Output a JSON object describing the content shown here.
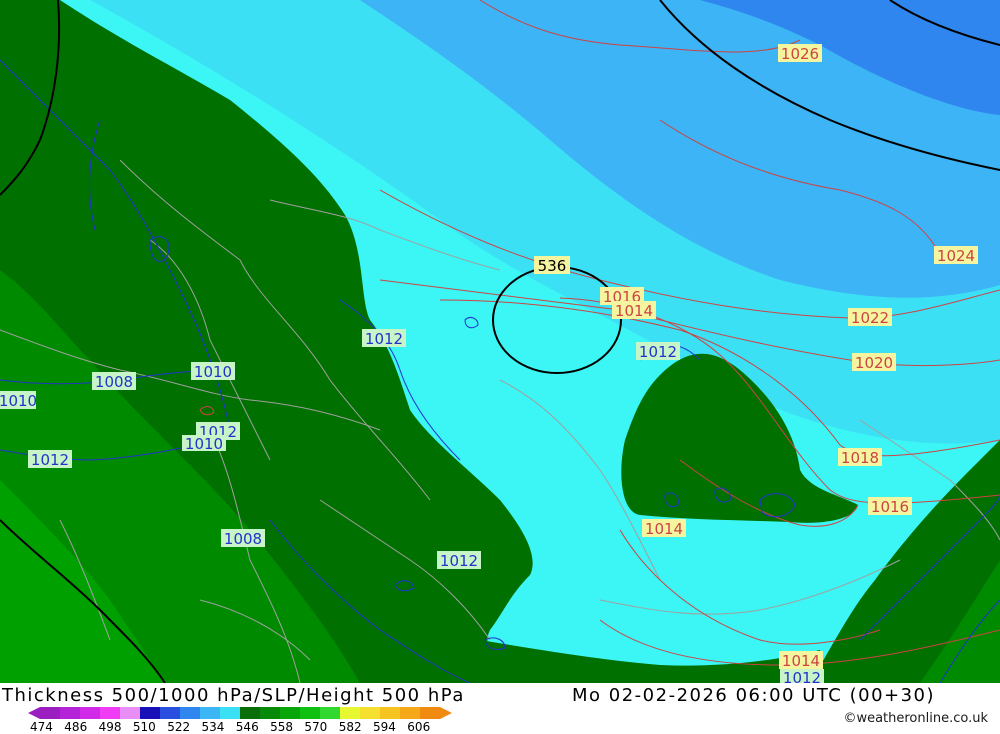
{
  "footer": {
    "title": "Thickness 500/1000 hPa/SLP/Height 500 hPa",
    "valid_time": "Mo 02-02-2026 06:00 UTC (00+30)",
    "credit": "©weatheronline.co.uk"
  },
  "legend": {
    "ticks": [
      "474",
      "486",
      "498",
      "510",
      "522",
      "534",
      "546",
      "558",
      "570",
      "582",
      "594",
      "606"
    ],
    "colors": [
      "#9b1fc0",
      "#b423d8",
      "#d02ae8",
      "#f03cf5",
      "#e88ef5",
      "#1a10b8",
      "#2a4fe0",
      "#2f86ee",
      "#3cb6f5",
      "#3ce0f5",
      "#0a6e0a",
      "#078a07",
      "#08a608",
      "#10c010",
      "#30d830",
      "#e8f830",
      "#f5e030",
      "#f5c420",
      "#f5a818",
      "#f08a10"
    ]
  },
  "map": {
    "colors": {
      "dark_green": "#007000",
      "mid_green": "#008a00",
      "green": "#00a000",
      "cyan": "#3cf5f5",
      "light_cyan": "#3ce0f5",
      "sky_blue": "#3cb4f5",
      "blue": "#2f86ee",
      "isobar_red": "#cc4444",
      "isobar_blue": "#2233cc",
      "coast_gray": "#a0a0a0",
      "label_bg_yellow": "#f5f5a0",
      "label_bg_green": "#c8f5c8"
    },
    "height_labels": [
      "536"
    ],
    "pressure_labels": [
      {
        "text": "1026",
        "style": "red"
      },
      {
        "text": "1024",
        "style": "red"
      },
      {
        "text": "1022",
        "style": "red"
      },
      {
        "text": "1020",
        "style": "red"
      },
      {
        "text": "1018",
        "style": "red"
      },
      {
        "text": "1016",
        "style": "red"
      },
      {
        "text": "1016",
        "style": "red"
      },
      {
        "text": "1014",
        "style": "red"
      },
      {
        "text": "1014",
        "style": "red"
      },
      {
        "text": "1014",
        "style": "red"
      },
      {
        "text": "1012",
        "style": "blue"
      },
      {
        "text": "1012",
        "style": "blue"
      },
      {
        "text": "1012",
        "style": "blue"
      },
      {
        "text": "1012",
        "style": "blue"
      },
      {
        "text": "1012",
        "style": "blue"
      },
      {
        "text": "1012",
        "style": "blue"
      },
      {
        "text": "1010",
        "style": "blue"
      },
      {
        "text": "1010",
        "style": "blue"
      },
      {
        "text": "1010",
        "style": "blue"
      },
      {
        "text": "1008",
        "style": "blue"
      },
      {
        "text": "1008",
        "style": "blue"
      }
    ]
  }
}
